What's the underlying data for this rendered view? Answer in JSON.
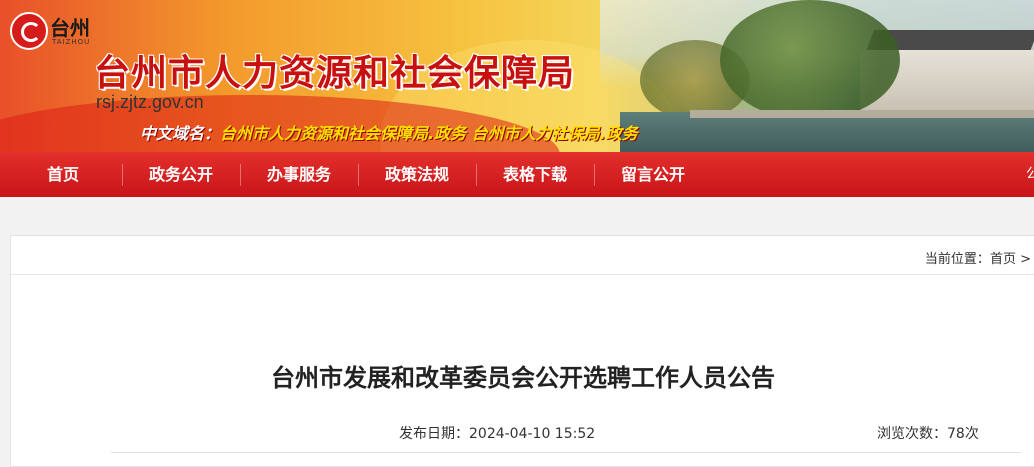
{
  "header": {
    "logo_text": "台州",
    "logo_sub": "TAIZHOU",
    "site_title": "台州市人力资源和社会保障局",
    "domain_url": "rsj.zjtz.gov.cn",
    "cn_domain_label": "中文域名：",
    "cn_domain_value": "台州市人力资源和社会保障局.政务  台州市人力社保局.政务"
  },
  "nav": {
    "items": [
      {
        "label": "首页"
      },
      {
        "label": "政务公开"
      },
      {
        "label": "办事服务"
      },
      {
        "label": "政策法规"
      },
      {
        "label": "表格下载"
      },
      {
        "label": "留言公开"
      }
    ],
    "more_label": "公"
  },
  "breadcrumb": {
    "prefix": "当前位置：",
    "home": "首页",
    "separator": ">"
  },
  "article": {
    "title": "台州市发展和改革委员会公开选聘工作人员公告",
    "date_label": "发布日期：",
    "date_value": "2024-04-10 15:52",
    "views_label": "浏览次数：",
    "views_value": "78次"
  },
  "colors": {
    "brand_red": "#c8141a",
    "title_red": "#c7100f"
  }
}
